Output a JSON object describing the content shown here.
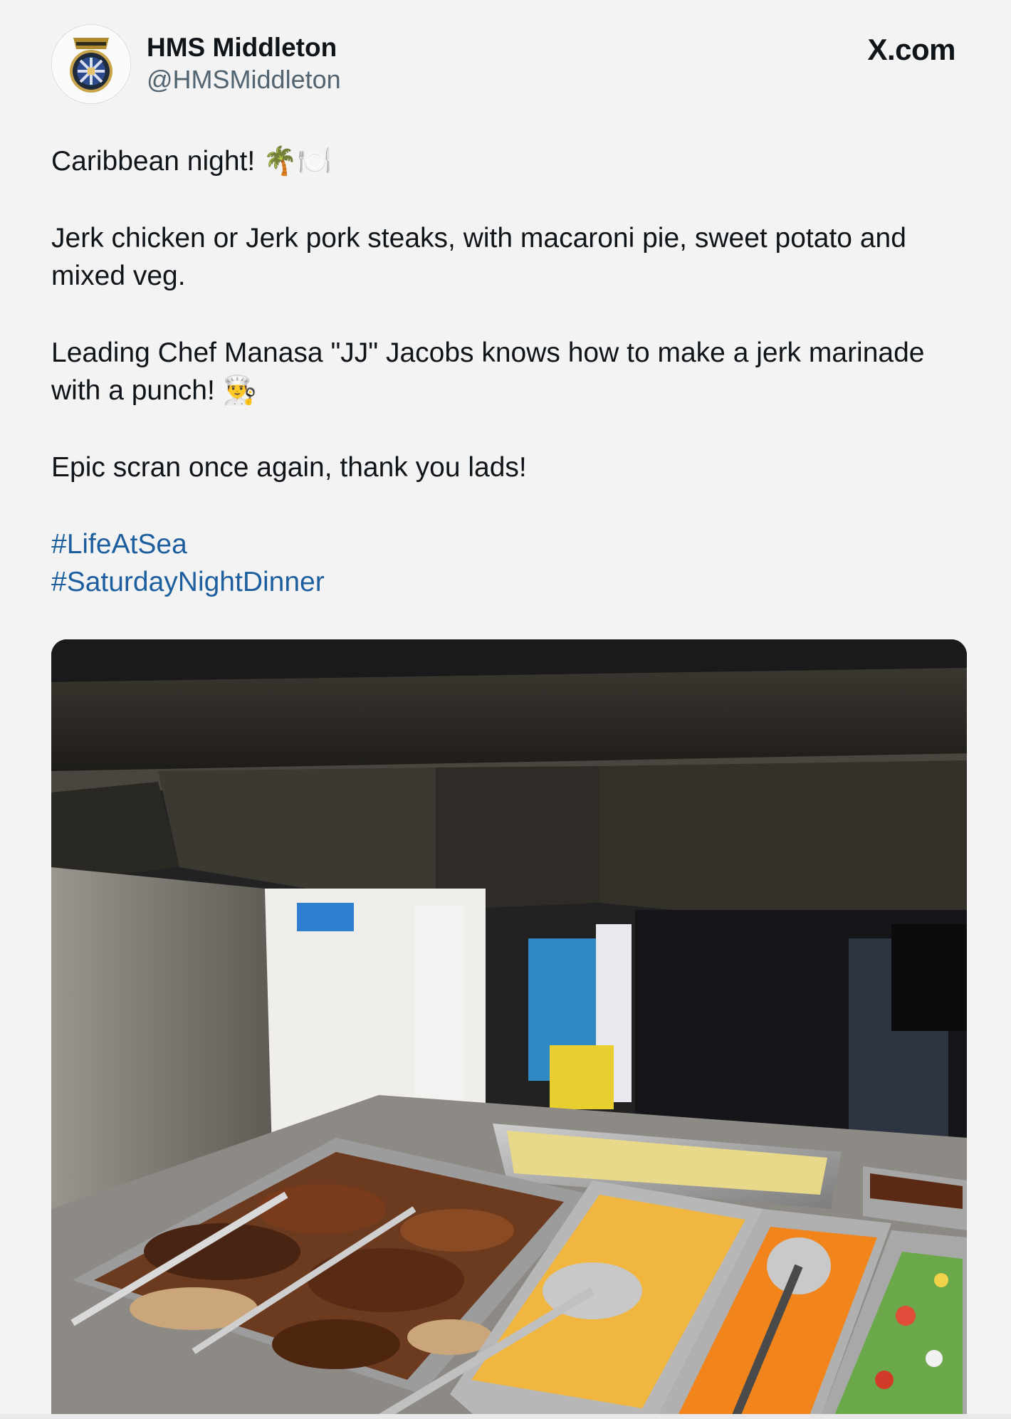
{
  "account": {
    "display_name": "HMS Middleton",
    "handle": "@HMSMiddleton",
    "avatar_icon": "navy-ship-crest-icon"
  },
  "brand": {
    "label": "X.com",
    "icon": "x-logo-icon"
  },
  "post": {
    "line1": "Caribbean night! 🌴🍽️",
    "line2": "Jerk chicken or Jerk pork steaks, with macaroni pie, sweet potato and mixed veg.",
    "line3": "Leading Chef Manasa \"JJ\" Jacobs knows how to make a jerk marinade with a punch! 👨‍🍳",
    "line4": "Epic scran once again, thank you lads!",
    "hashtags": [
      "#LifeAtSea",
      "#SaturdayNightDinner"
    ]
  },
  "colors": {
    "background": "#f3f3f4",
    "text": "#0f1419",
    "secondary_text": "#536471",
    "link": "#1d5f9e"
  }
}
